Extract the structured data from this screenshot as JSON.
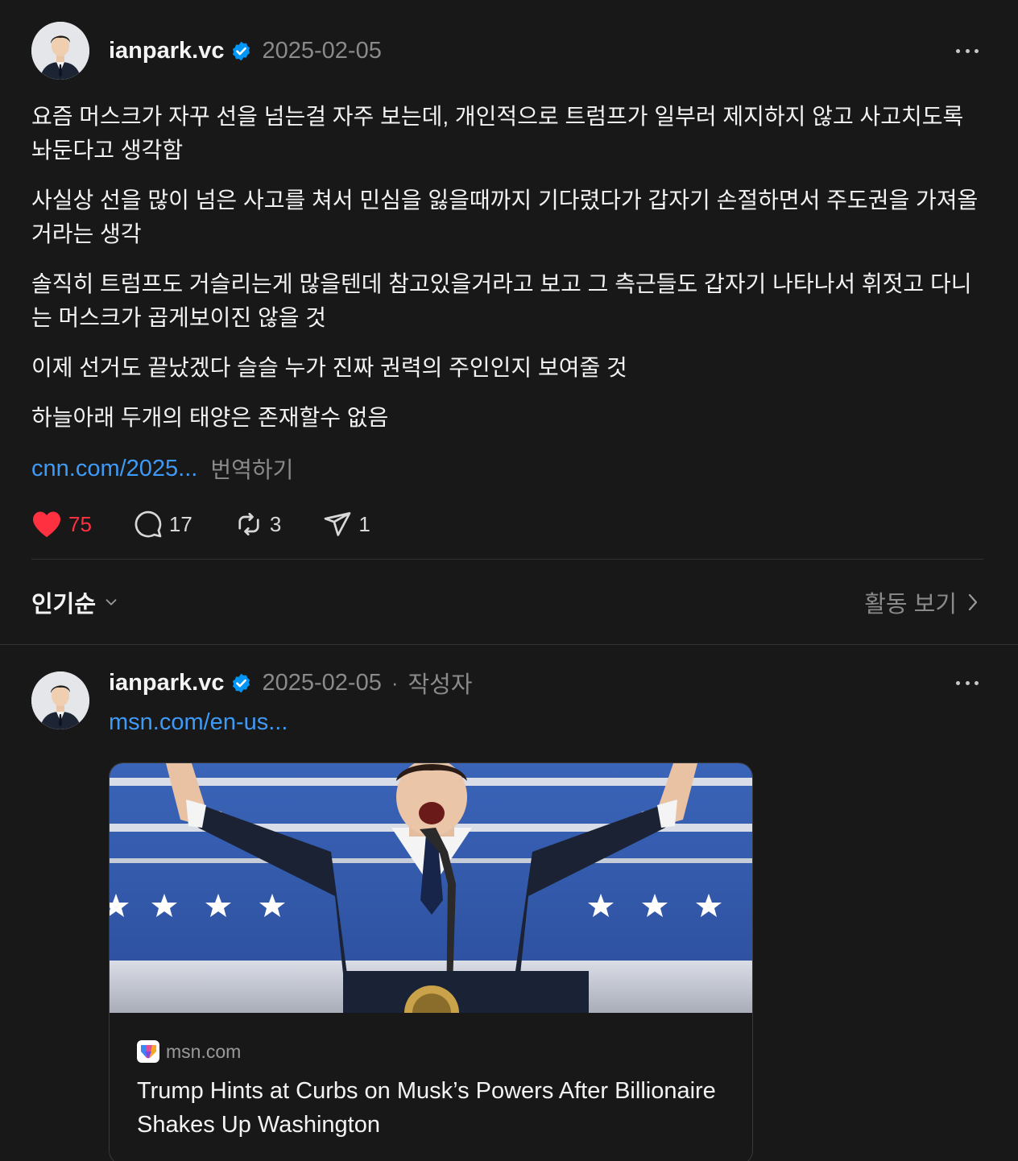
{
  "post": {
    "username": "ianpark.vc",
    "date": "2025-02-05",
    "paragraphs": [
      "요즘 머스크가 자꾸 선을 넘는걸 자주 보는데, 개인적으로 트럼프가 일부러 제지하지 않고 사고치도록 놔둔다고 생각함",
      "사실상 선을 많이 넘은 사고를 쳐서 민심을 잃을때까지 기다렸다가 갑자기 손절하면서 주도권을 가져올거라는 생각",
      "솔직히 트럼프도 거슬리는게 많을텐데 참고있을거라고 보고 그 측근들도 갑자기 나타나서 휘젓고 다니는 머스크가 곱게보이진 않을 것",
      "이제 선거도 끝났겠다 슬슬 누가 진짜 권력의 주인인지 보여줄 것",
      "하늘아래 두개의 태양은 존재할수 없음"
    ],
    "link_text": "cnn.com/2025...",
    "translate_label": "번역하기",
    "likes": "75",
    "comments": "17",
    "reposts": "3",
    "shares": "1"
  },
  "sort": {
    "label": "인기순",
    "activity_label": "활동 보기"
  },
  "reply": {
    "username": "ianpark.vc",
    "date": "2025-02-05",
    "separator": "·",
    "author_tag": "작성자",
    "link_text": "msn.com/en-us...",
    "card": {
      "source": "msn.com",
      "title": "Trump Hints at Curbs on Musk’s Powers After Billionaire Shakes Up Washington"
    }
  },
  "colors": {
    "background": "#181818",
    "link": "#3f9af5",
    "like": "#ff3040",
    "verified": "#0095f6",
    "muted": "#8a8a8a"
  },
  "icons": [
    "verified-badge-icon",
    "more-icon",
    "heart-icon",
    "comment-icon",
    "repost-icon",
    "share-icon",
    "chevron-down-icon",
    "chevron-right-icon",
    "msn-favicon-icon"
  ]
}
